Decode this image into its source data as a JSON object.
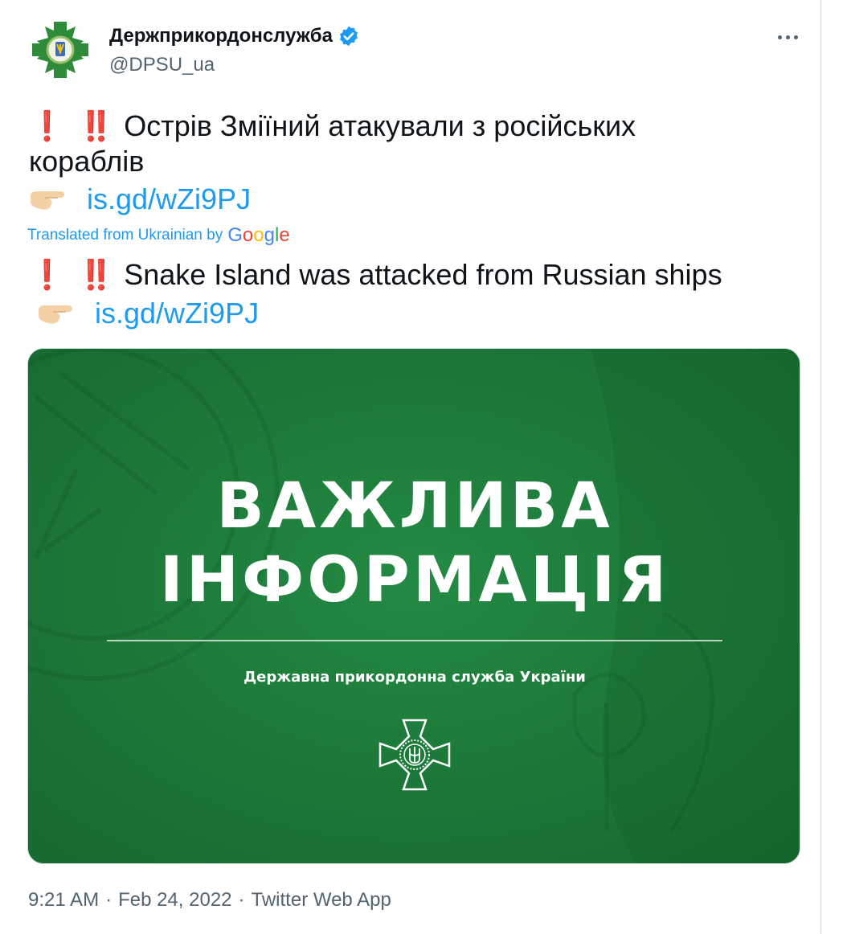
{
  "author": {
    "display_name": "Держприкордонслужба",
    "handle": "@DPSU_ua",
    "verified_icon": "verified-badge-icon",
    "avatar_icon": "border-service-cross-emblem"
  },
  "menu": {
    "more_icon": "more-horizontal-icon"
  },
  "original": {
    "emphasis": "❗ ‼️",
    "line1": "Острів Зміїний атакували з російських",
    "line2": "кораблів",
    "link": "is.gd/wZi9PJ"
  },
  "translation": {
    "label": "Translated from Ukrainian by",
    "provider": "Google",
    "emphasis": "❗ ‼️",
    "line1": "Snake Island was attacked from Russian ships",
    "link": "is.gd/wZi9PJ"
  },
  "media": {
    "headline_line1": "ВАЖЛИВА",
    "headline_line2": "ІНФОРМАЦІЯ",
    "subtitle": "Державна прикордонна служба України",
    "emblem_icon": "border-service-cross-emblem",
    "background_color": "#1c7a3a"
  },
  "meta": {
    "time": "9:21 AM",
    "date": "Feb 24, 2022",
    "source": "Twitter Web App",
    "separator": "·"
  },
  "colors": {
    "link": "#1d9bf0",
    "secondary_text": "#536471",
    "emphasis_red": "#d0262e",
    "verified": "#1d9bf0"
  }
}
